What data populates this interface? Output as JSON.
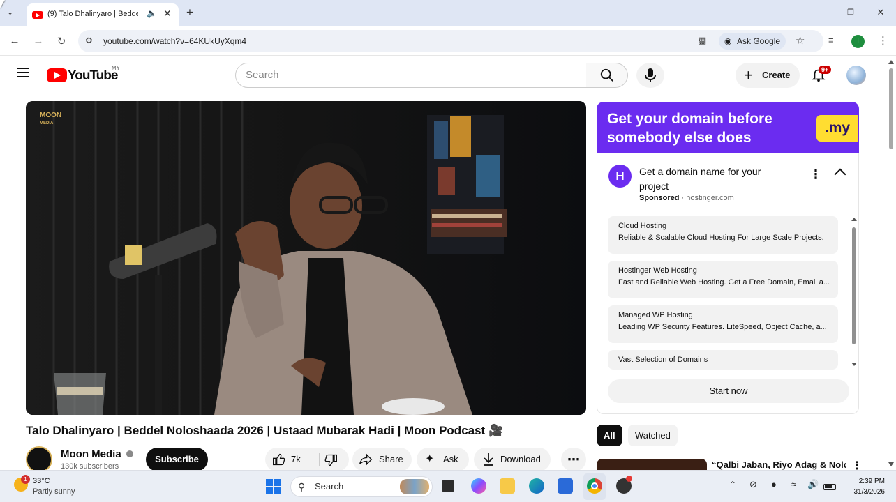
{
  "browser": {
    "tab_title": "(9) Talo Dhalinyaro | Beddel",
    "url": "youtube.com/watch?v=64KUkUyXqm4",
    "ask_google": "Ask Google",
    "profile_initial": "I"
  },
  "youtube": {
    "logo_text": "YouTube",
    "country_code": "MY",
    "search_placeholder": "Search",
    "create_label": "Create",
    "notif_count": "9+"
  },
  "video": {
    "title": "Talo Dhalinyaro | Beddel Noloshaada 2026 | Ustaad Mubarak Hadi | Moon Podcast 🎥",
    "watermark": "MOON",
    "watermark_sub": "MEDIA",
    "channel": "Moon Media",
    "subscribers": "130k subscribers",
    "subscribe_label": "Subscribe",
    "like_count": "7k",
    "share_label": "Share",
    "ask_label": "Ask",
    "download_label": "Download"
  },
  "ad": {
    "banner_text_1": "Get your domain before",
    "banner_text_2": "somebody else does",
    "banner_tld": ".my",
    "headline_1": "Get a domain name for your",
    "headline_2": "project",
    "sponsored": "Sponsored",
    "domain": "hostinger.com",
    "sitelinks": [
      {
        "title": "Cloud Hosting",
        "desc": "Reliable & Scalable Cloud Hosting For Large Scale Projects."
      },
      {
        "title": "Hostinger Web Hosting",
        "desc": "Fast and Reliable Web Hosting. Get a Free Domain, Email a..."
      },
      {
        "title": "Managed WP Hosting",
        "desc": "Leading WP Security Features. LiteSpeed, Object Cache, a..."
      },
      {
        "title": "Vast Selection of Domains",
        "desc": ""
      }
    ],
    "cta": "Start now"
  },
  "filters": {
    "all": "All",
    "watched": "Watched"
  },
  "next_video": {
    "title": "“Qalbi Jaban, Riyo Adag & Nolol"
  },
  "taskbar": {
    "temperature": "33°C",
    "weather": "Partly sunny",
    "weather_badge": "1",
    "search_label": "Search",
    "time": "2:39 PM",
    "date": "31/3/2026"
  },
  "colors": {
    "youtube_red": "#ff0000",
    "ad_purple": "#6b2cf0",
    "ad_yellow": "#ffdd31",
    "subscribe_black": "#0f0f0f"
  }
}
